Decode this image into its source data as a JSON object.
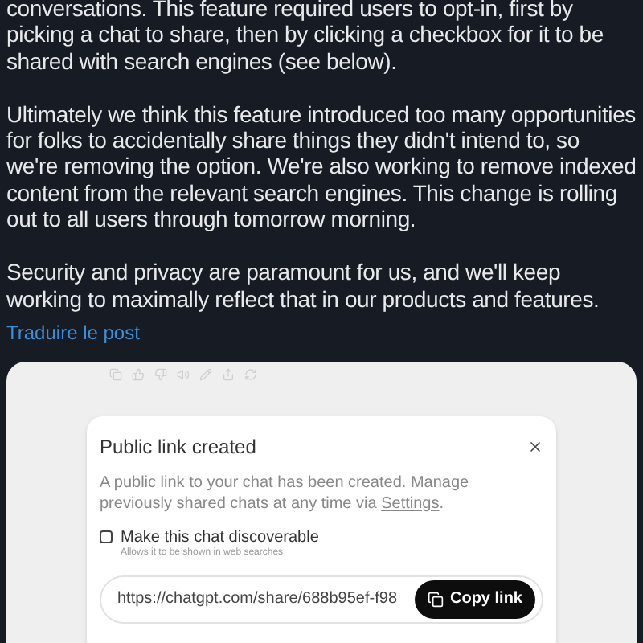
{
  "post": {
    "paragraphs": [
      "conversations. This feature required users to opt-in, first by picking a chat to share, then by clicking a checkbox for it to be shared with search engines (see below).",
      "Ultimately we think this feature introduced too many opportunities for folks to accidentally share things they didn't intend to, so we're removing the option. We're also working to remove indexed content from the relevant search engines. This change is rolling out to all users through tomorrow morning.",
      "Security and privacy are paramount for us, and we'll keep working to maximally reflect that in our products and features."
    ],
    "translate_link": "Traduire le post"
  },
  "dialog": {
    "title": "Public link created",
    "description_before": "A public link to your chat has been created. Manage previously shared chats at any time via ",
    "settings_link": "Settings",
    "description_after": ".",
    "checkbox": {
      "label": "Make this chat discoverable",
      "hint": "Allows it to be shown in web searches",
      "checked": false
    },
    "url": "https://chatgpt.com/share/688b95ef-f98",
    "copy_button": "Copy link"
  }
}
